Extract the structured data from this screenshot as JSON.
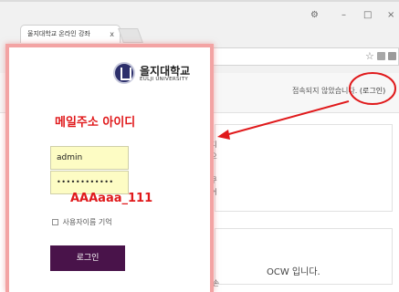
{
  "browser": {
    "tab_title": "울지대학교 온라인 강좌",
    "tab_close": "x",
    "window_controls": [
      "æ",
      "–",
      "□",
      "×"
    ],
    "star_icon": "star-icon"
  },
  "site": {
    "not_logged_in": "접속되지 않았습니다.",
    "login_link": "(로그인)",
    "info_1": "사용자 아이디\n밀번호를 잊으\n까?",
    "info_2": "브라우저의 쿠\n능이 작동되어\n다.",
    "info_3": "어떤 강좌는 손",
    "ocw_text": "OCW 입니다."
  },
  "login_panel": {
    "logo_kr": "을지대학교",
    "logo_en": "EULJI UNIVERSITY",
    "username_value": "admin",
    "password_value": "••••••••••••",
    "remember_label": "사용자이름 기억",
    "login_button": "로그인"
  },
  "annotations": {
    "email_id": "메일주소 아이디",
    "password_hint": "AAAaaa_111",
    "color": "#e0191b"
  }
}
